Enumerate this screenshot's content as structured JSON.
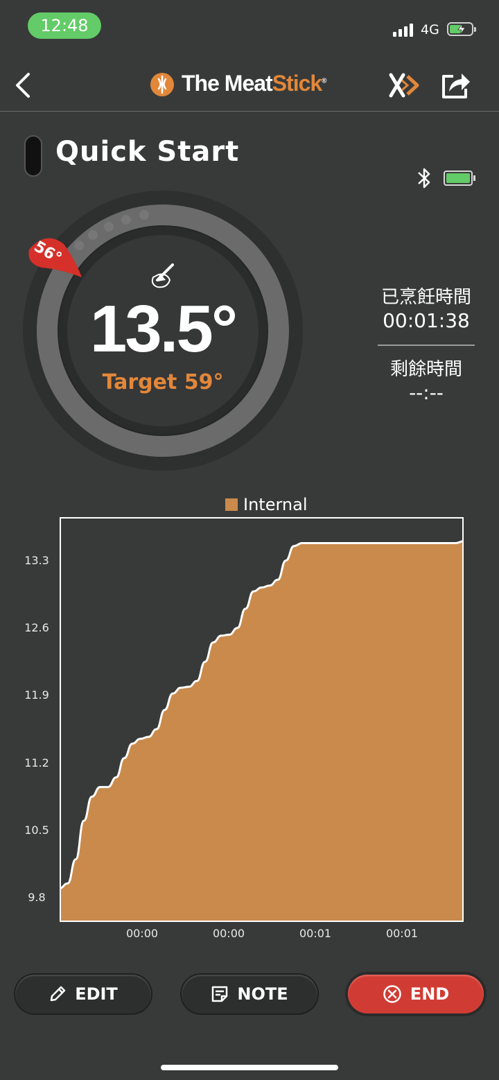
{
  "status_bar": {
    "time": "12:48",
    "network": "4G"
  },
  "header": {
    "back_icon": "chevron-left-icon",
    "logo_part1": "The Meat",
    "logo_part2": "Stick",
    "logo_mark": "®",
    "brand_icon": "meatstick-x-icon",
    "share_icon": "share-icon"
  },
  "session": {
    "title": "Quick Start",
    "bluetooth_icon": "bluetooth-icon",
    "battery_icon": "battery-full-icon"
  },
  "gauge": {
    "current_temp": "13.5°",
    "target_label": "Target 59°",
    "ambient_pin_label": "56°",
    "food_icon": "meat-probe-icon"
  },
  "timers": {
    "cooked_label": "已烹飪時間",
    "cooked_value": "00:01:38",
    "remaining_label": "剩餘時間",
    "remaining_value": "--:--"
  },
  "chart_data": {
    "type": "area",
    "series": [
      {
        "name": "Internal",
        "x": [
          0,
          1,
          2,
          3,
          4,
          5,
          6,
          7,
          8,
          9,
          10,
          11,
          12,
          13,
          14,
          15,
          16,
          17,
          18,
          19,
          20,
          21,
          22,
          23,
          24,
          25,
          26,
          27,
          28,
          29,
          30,
          31,
          32,
          33,
          34,
          35,
          36,
          37,
          38,
          39,
          40,
          41,
          42,
          43,
          44,
          45,
          46,
          47,
          48,
          49,
          50
        ],
        "values": [
          9.9,
          9.95,
          10.2,
          10.6,
          10.85,
          10.95,
          10.95,
          11.05,
          11.25,
          11.4,
          11.45,
          11.47,
          11.55,
          11.75,
          11.92,
          11.98,
          11.99,
          12.05,
          12.25,
          12.45,
          12.52,
          12.53,
          12.6,
          12.8,
          12.98,
          13.02,
          13.04,
          13.1,
          13.3,
          13.45,
          13.48,
          13.48,
          13.48,
          13.48,
          13.48,
          13.48,
          13.48,
          13.48,
          13.48,
          13.48,
          13.48,
          13.48,
          13.48,
          13.48,
          13.48,
          13.48,
          13.48,
          13.48,
          13.48,
          13.48,
          13.5
        ]
      }
    ],
    "legend": "Internal",
    "legend_color": "#c98a4b",
    "y_ticks": [
      "13.3",
      "12.6",
      "11.9",
      "11.2",
      "10.5",
      "9.8"
    ],
    "x_ticks": [
      "00:00",
      "00:00",
      "00:01",
      "00:01"
    ],
    "ylim": [
      9.55,
      13.75
    ],
    "grid": false
  },
  "actions": {
    "edit_label": "EDIT",
    "edit_icon": "pencil-icon",
    "note_label": "NOTE",
    "note_icon": "note-icon",
    "end_label": "END",
    "end_icon": "circle-x-icon"
  },
  "colors": {
    "accent": "#e2873a",
    "chart_fill": "#c98a4b",
    "end_button": "#d03c34",
    "background": "#383a39"
  }
}
